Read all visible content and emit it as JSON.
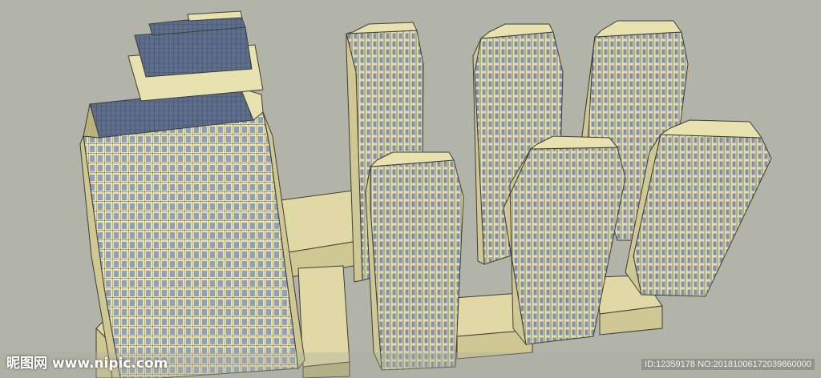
{
  "colors": {
    "sky": "#b3b4a9",
    "facade": "#e8e2b0",
    "facade_shade": "#cfc894",
    "facade_dark": "#b9b27c",
    "glass": "#5d6e8c",
    "window": "#8fa0b8",
    "podium": "#e0d9a6",
    "line": "#3d3d36"
  },
  "scene": {
    "subject": "towers",
    "tower_count": 7
  },
  "watermark": {
    "left": "昵图网 www.nipic.com",
    "right": "ID:12359178 NO:20181006172039860000"
  }
}
